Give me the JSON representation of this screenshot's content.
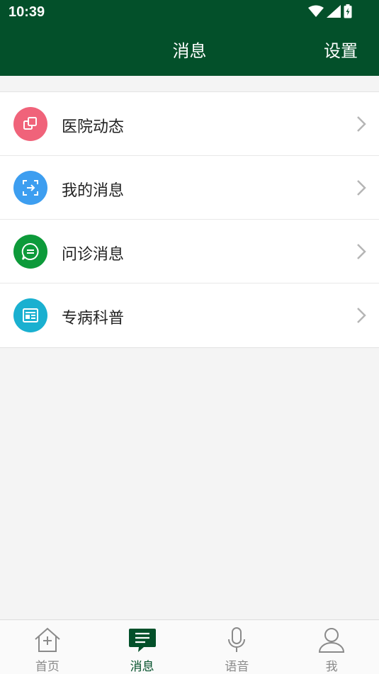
{
  "status_bar": {
    "time": "10:39"
  },
  "header": {
    "title": "消息",
    "settings_label": "设置"
  },
  "menu": [
    {
      "label": "医院动态",
      "icon": "hospital-news-icon",
      "color": "#f0637a"
    },
    {
      "label": "我的消息",
      "icon": "my-message-icon",
      "color": "#3d9ef0"
    },
    {
      "label": "问诊消息",
      "icon": "consultation-chat-icon",
      "color": "#0d9a3a"
    },
    {
      "label": "专病科普",
      "icon": "article-icon",
      "color": "#1ab0d0"
    }
  ],
  "tabs": [
    {
      "label": "首页",
      "icon": "home-icon",
      "active": false
    },
    {
      "label": "消息",
      "icon": "message-icon",
      "active": true
    },
    {
      "label": "语音",
      "icon": "microphone-icon",
      "active": false
    },
    {
      "label": "我",
      "icon": "person-icon",
      "active": false
    }
  ],
  "colors": {
    "primary": "#03502a",
    "background": "#f4f4f4"
  }
}
